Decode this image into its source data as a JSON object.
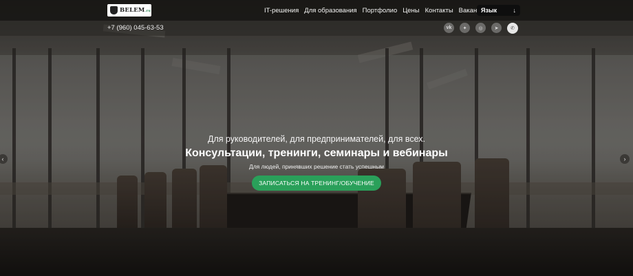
{
  "header": {
    "logo_text": "BELEM",
    "logo_suffix": ".ru",
    "nav": [
      "IT-решения",
      "Для образования",
      "Портфолио",
      "Цены",
      "Контакты",
      "Вакансии"
    ],
    "lang_label": "Язык",
    "lang_arrow": "↓"
  },
  "subbar": {
    "phone": "+7 (960) 045-63-53",
    "socials": [
      "vk-icon",
      "twitter-icon",
      "instagram-icon",
      "telegram-icon",
      "whatsapp-icon"
    ],
    "social_glyphs": [
      "vk",
      "✦",
      "◎",
      "➤",
      "✆"
    ]
  },
  "hero": {
    "pre": "Для руководителей, для предпринимателей, для всех.",
    "title": "Консультации, тренинги, семинары и вебинары",
    "sub": "Для людей, принявших решение стать успешным",
    "cta": "ЗАПИСАТЬСЯ НА ТРЕНИНГ/ОБУЧЕНИЕ"
  },
  "carousel": {
    "prev": "‹",
    "next": "›"
  },
  "colors": {
    "accent": "#2aa05a",
    "header_bg": "#191816"
  }
}
